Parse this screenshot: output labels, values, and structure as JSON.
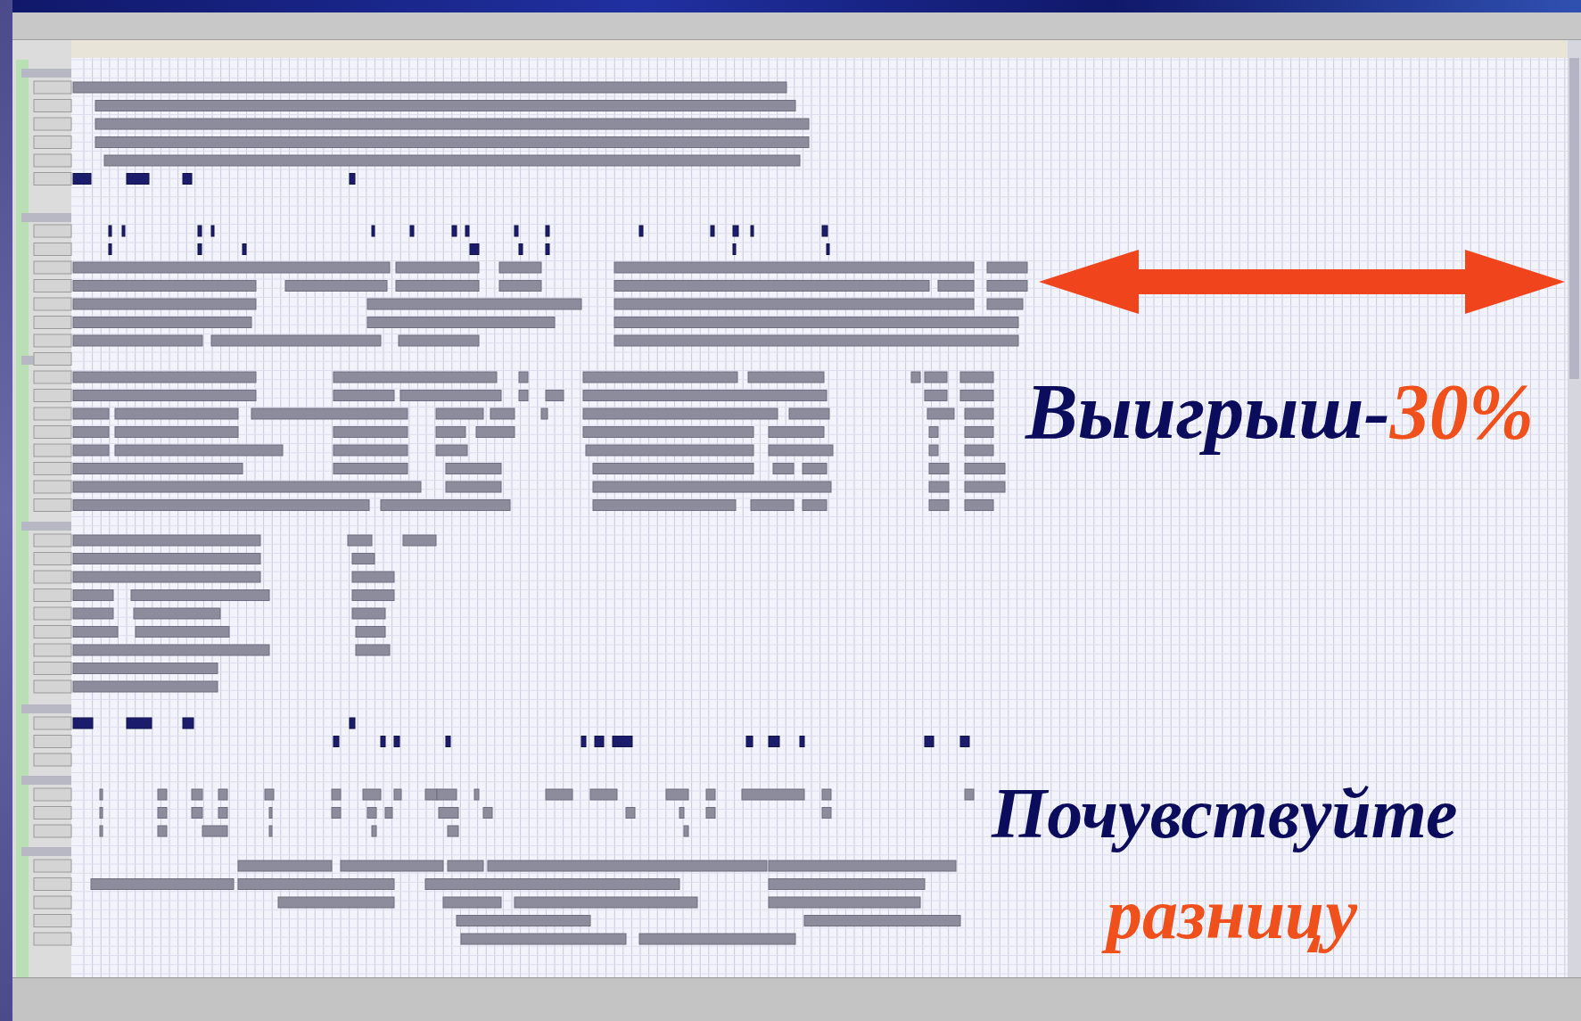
{
  "slide_text": {
    "gain_label": "Выигрыш-",
    "gain_value": "30%",
    "tagline_line_1": "Почувствуйте",
    "tagline_line_2": "разницу"
  }
}
